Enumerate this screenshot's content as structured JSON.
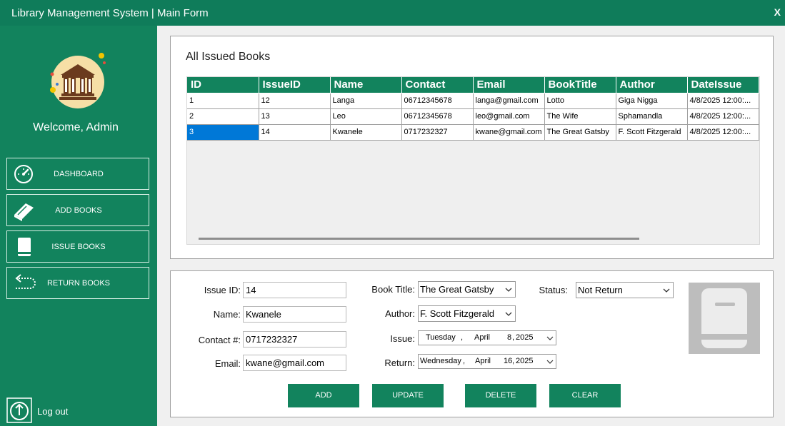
{
  "window": {
    "title": "Library Management System | Main Form",
    "close_label": "X"
  },
  "sidebar": {
    "welcome": "Welcome, Admin",
    "nav": [
      {
        "label": "DASHBOARD",
        "icon": "speedometer-icon"
      },
      {
        "label": "ADD BOOKS",
        "icon": "book-icon"
      },
      {
        "label": "ISSUE BOOKS",
        "icon": "closed-book-icon"
      },
      {
        "label": "RETURN BOOKS",
        "icon": "return-arrow-icon"
      }
    ],
    "logout_label": "Log out"
  },
  "issued_books": {
    "title": "All Issued Books",
    "columns": [
      "ID",
      "IssueID",
      "Name",
      "Contact",
      "Email",
      "BookTitle",
      "Author",
      "DateIssue"
    ],
    "rows": [
      [
        "1",
        "12",
        "Langa",
        "06712345678",
        "langa@gmail.com",
        "Lotto",
        "Giga Nigga",
        "4/8/2025 12:00:..."
      ],
      [
        "2",
        "13",
        "Leo",
        "06712345678",
        "leo@gmail.com",
        "The Wife",
        "Sphamandla",
        "4/8/2025 12:00:..."
      ],
      [
        "3",
        "14",
        "Kwanele",
        "0717232327",
        "kwane@gmail.com",
        "The Great Gatsby",
        "F. Scott Fitzgerald",
        "4/8/2025 12:00:..."
      ]
    ],
    "selected_row": 2
  },
  "form": {
    "issue_id_label": "Issue ID:",
    "issue_id_value": "14",
    "name_label": "Name:",
    "name_value": "Kwanele",
    "contact_label": "Contact #:",
    "contact_value": "0717232327",
    "email_label": "Email:",
    "email_value": "kwane@gmail.com",
    "book_title_label": "Book Title:",
    "book_title_value": "The Great Gatsby",
    "author_label": "Author:",
    "author_value": "F. Scott Fitzgerald",
    "issue_label": "Issue:",
    "issue_date": {
      "weekday": "Tuesday",
      "month": "April",
      "day": "8",
      "year": "2025"
    },
    "return_label": "Return:",
    "return_date": {
      "weekday": "Wednesday",
      "month": "April",
      "day": "16",
      "year": "2025"
    },
    "status_label": "Status:",
    "status_value": "Not Return"
  },
  "actions": {
    "add": "ADD",
    "update": "UPDATE",
    "delete": "DELETE",
    "clear": "CLEAR"
  },
  "colors": {
    "primary": "#12835d",
    "titlebar": "#0f7c5a",
    "selection": "#0078d7"
  }
}
